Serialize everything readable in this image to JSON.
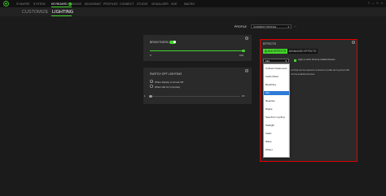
{
  "app": {
    "top_nav": [
      {
        "label": "SYNAPSE",
        "active": false
      },
      {
        "label": "SYSTEM",
        "active": false
      },
      {
        "label": "KEYBOARD",
        "active": true,
        "badge": "2"
      },
      {
        "label": "MOUSE",
        "active": false
      },
      {
        "label": "MOUSEMAT",
        "active": false
      },
      {
        "label": "PROFILES",
        "active": false
      },
      {
        "label": "CONNECT",
        "active": false
      },
      {
        "label": "STUDIO",
        "active": false
      },
      {
        "label": "VISUALIZER",
        "active": false
      },
      {
        "label": "HUE",
        "active": false
      },
      {
        "label": "MACRO",
        "active": false
      }
    ],
    "window_controls": [
      "?",
      "–",
      "□",
      "×"
    ]
  },
  "sub_nav": {
    "tabs": [
      {
        "label": "CUSTOMIZE",
        "active": false
      },
      {
        "label": "LIGHTING",
        "active": true
      }
    ]
  },
  "profile": {
    "label": "PROFILE",
    "value": "CURRENT PROFILE",
    "more": "···"
  },
  "brightness": {
    "title": "BRIGHTNESS",
    "enabled": true,
    "min_label": "0",
    "max_label": "100",
    "value_percent": 100,
    "info": "i"
  },
  "switch_off": {
    "title": "SWITCH OFF LIGHTING",
    "option_display_off": "When display is turned Off",
    "option_idle": "When idle for (minutes)",
    "min_label": "1",
    "max_label": "15",
    "info": "i"
  },
  "effects": {
    "title": "EFFECTS",
    "tab_quick": "QUICK EFFECTS",
    "tab_advanced": "ADVANCED EFFECTS",
    "selected": "Fire",
    "apply_label": "Apply to other Chroma enabled devices",
    "description_line1": "ect that can be saved to a device's profile and synced with",
    "description_line2": "hroma-enabled devices.",
    "options": [
      "Ambient Awareness",
      "Audio Meter",
      "Breathing",
      "Fire",
      "Reactive",
      "Ripple",
      "Spectrum Cycling",
      "Starlight",
      "Static",
      "Wave",
      "Wheel"
    ],
    "info": "i"
  },
  "colors": {
    "accent": "#44d62c",
    "highlight_border": "#e00000",
    "selected_item": "#2e7bd6"
  }
}
